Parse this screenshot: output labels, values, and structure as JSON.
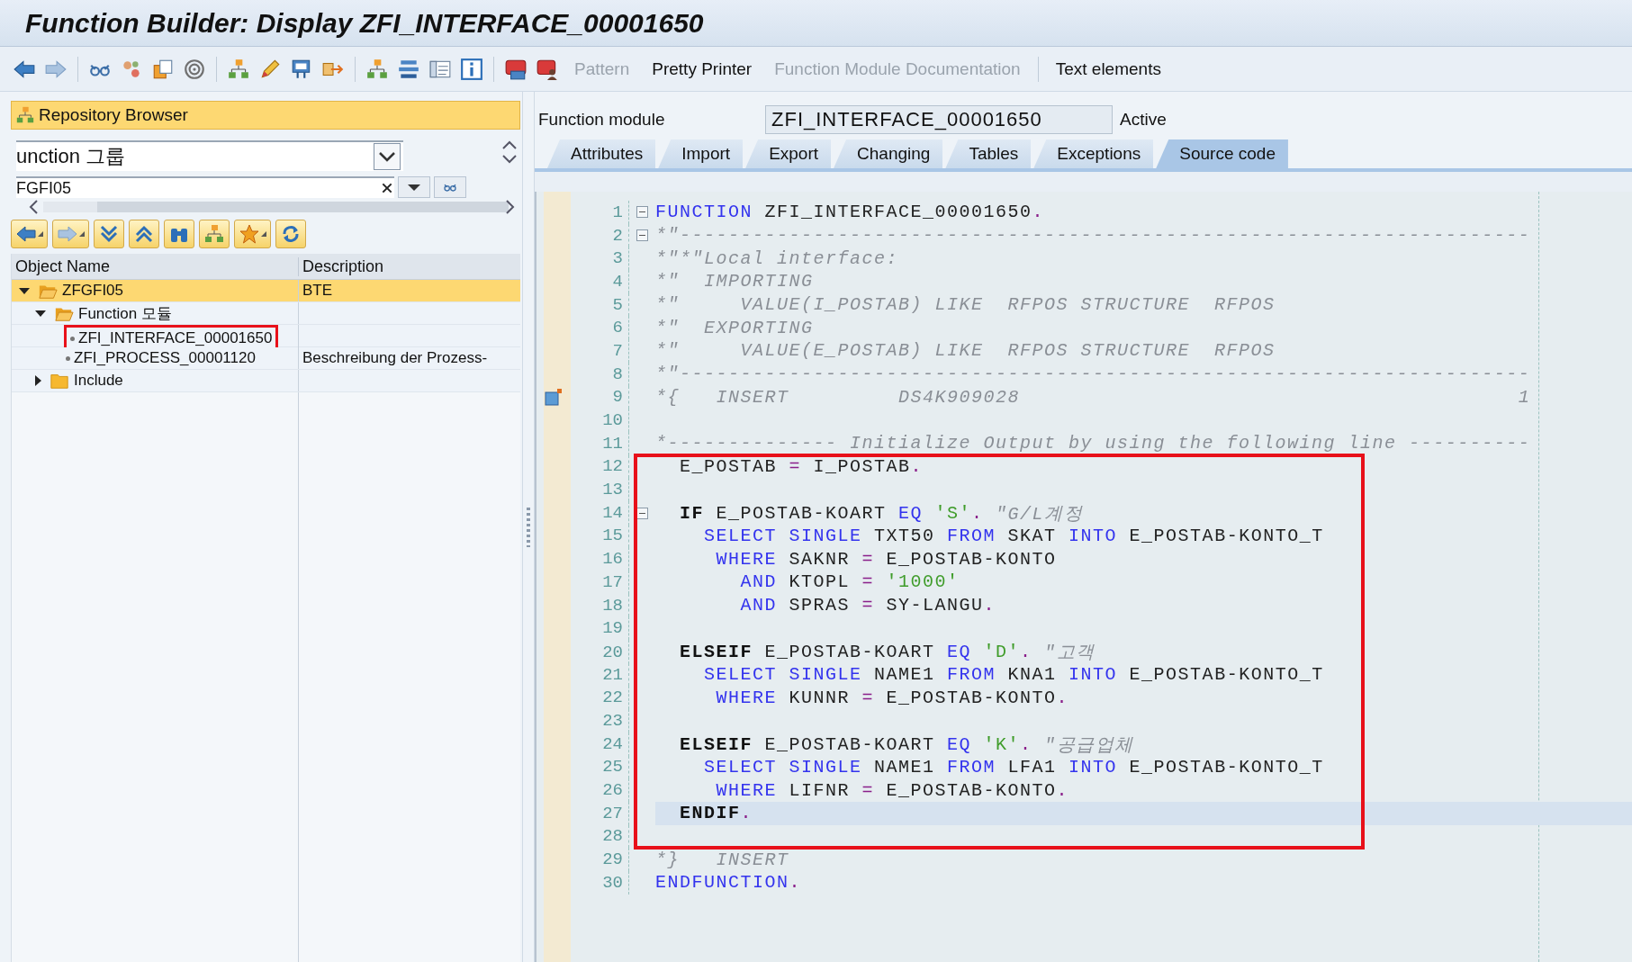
{
  "window": {
    "title": "Function Builder: Display ZFI_INTERFACE_00001650"
  },
  "toolbar": {
    "text_buttons": [
      {
        "label": "Pattern",
        "disabled": true
      },
      {
        "label": "Pretty Printer",
        "disabled": false
      },
      {
        "label": "Function Module Documentation",
        "disabled": true
      },
      {
        "label": "Text elements",
        "disabled": false
      }
    ]
  },
  "repository_browser": {
    "title": "Repository Browser",
    "object_type": "unction 그룹",
    "object_name": "FGFI05",
    "columns": [
      "Object Name",
      "Description"
    ],
    "tree": [
      {
        "name": "ZFGFI05",
        "description": "BTE",
        "kind": "folder",
        "expanded": true,
        "selected": true,
        "boxed": false,
        "children": [
          {
            "name": "Function 모듈",
            "kind": "folder",
            "expanded": true,
            "selected": false,
            "boxed": false,
            "children": [
              {
                "name": "ZFI_INTERFACE_00001650",
                "kind": "item",
                "selected": false,
                "boxed": true
              },
              {
                "name": "ZFI_PROCESS_00001120",
                "description": "Beschreibung der Prozess-",
                "kind": "item",
                "selected": false,
                "boxed": false
              }
            ]
          },
          {
            "name": "Include",
            "kind": "folder",
            "expanded": false,
            "selected": false,
            "boxed": false
          }
        ]
      }
    ]
  },
  "function_module": {
    "label": "Function module",
    "value": "ZFI_INTERFACE_00001650",
    "status": "Active"
  },
  "tabs": [
    {
      "label": "Attributes",
      "selected": false
    },
    {
      "label": "Import",
      "selected": false
    },
    {
      "label": "Export",
      "selected": false
    },
    {
      "label": "Changing",
      "selected": false
    },
    {
      "label": "Tables",
      "selected": false
    },
    {
      "label": "Exceptions",
      "selected": false
    },
    {
      "label": "Source code",
      "selected": true
    }
  ],
  "code_blocks": [
    {
      "boxed": false,
      "lines": [
        {
          "number": "1",
          "collapsible": true,
          "bookmark": false,
          "current": false,
          "tokens": [
            {
              "kind": "kw",
              "text": "FUNCTION"
            },
            {
              "kind": "txt",
              "text": " ZFI_INTERFACE_00001650"
            },
            {
              "kind": "op",
              "text": "."
            }
          ]
        },
        {
          "number": "2",
          "collapsible": true,
          "bookmark": false,
          "current": false,
          "tokens": [
            {
              "kind": "cmt",
              "text": "*\"----------------------------------------------------------------------"
            }
          ]
        },
        {
          "number": "3",
          "collapsible": false,
          "bookmark": false,
          "current": false,
          "tokens": [
            {
              "kind": "cmt",
              "text": "*\"*\"Local interface:"
            }
          ]
        },
        {
          "number": "4",
          "collapsible": false,
          "bookmark": false,
          "current": false,
          "tokens": [
            {
              "kind": "cmt",
              "text": "*\"  IMPORTING"
            }
          ]
        },
        {
          "number": "5",
          "collapsible": false,
          "bookmark": false,
          "current": false,
          "tokens": [
            {
              "kind": "cmt",
              "text": "*\"     VALUE(I_POSTAB) LIKE  RFPOS STRUCTURE  RFPOS"
            }
          ]
        },
        {
          "number": "6",
          "collapsible": false,
          "bookmark": false,
          "current": false,
          "tokens": [
            {
              "kind": "cmt",
              "text": "*\"  EXPORTING"
            }
          ]
        },
        {
          "number": "7",
          "collapsible": false,
          "bookmark": false,
          "current": false,
          "tokens": [
            {
              "kind": "cmt",
              "text": "*\"     VALUE(E_POSTAB) LIKE  RFPOS STRUCTURE  RFPOS"
            }
          ]
        },
        {
          "number": "8",
          "collapsible": false,
          "bookmark": false,
          "current": false,
          "tokens": [
            {
              "kind": "cmt",
              "text": "*\"----------------------------------------------------------------------"
            }
          ]
        },
        {
          "number": "9",
          "collapsible": false,
          "bookmark": true,
          "current": false,
          "tokens": [
            {
              "kind": "cmt",
              "text": "*{   INSERT         DS4K909028                                         1"
            }
          ]
        },
        {
          "number": "10",
          "collapsible": false,
          "bookmark": false,
          "current": false
        },
        {
          "number": "11",
          "collapsible": false,
          "bookmark": false,
          "current": false,
          "tokens": [
            {
              "kind": "cmt",
              "text": "*-------------- Initialize Output by using the following line ----------"
            }
          ]
        }
      ]
    },
    {
      "boxed": true,
      "lines": [
        {
          "number": "12",
          "collapsible": false,
          "bookmark": false,
          "current": false,
          "tokens": [
            {
              "kind": "txt",
              "text": "  E_POSTAB "
            },
            {
              "kind": "op",
              "text": "="
            },
            {
              "kind": "txt",
              "text": " I_POSTAB"
            },
            {
              "kind": "op",
              "text": "."
            }
          ]
        },
        {
          "number": "13",
          "collapsible": false,
          "bookmark": false,
          "current": false
        },
        {
          "number": "14",
          "collapsible": true,
          "bookmark": false,
          "current": false,
          "tokens": [
            {
              "kind": "bold",
              "text": "  IF"
            },
            {
              "kind": "txt",
              "text": " E_POSTAB-KOART "
            },
            {
              "kind": "kw",
              "text": "EQ"
            },
            {
              "kind": "str",
              "text": " 'S'"
            },
            {
              "kind": "op",
              "text": "."
            },
            {
              "kind": "cmt",
              "text": " \"G/L계정"
            }
          ]
        },
        {
          "number": "15",
          "collapsible": false,
          "bookmark": false,
          "current": false,
          "tokens": [
            {
              "kind": "kw",
              "text": "    SELECT"
            },
            {
              "kind": "kw",
              "text": " SINGLE"
            },
            {
              "kind": "txt",
              "text": " TXT50 "
            },
            {
              "kind": "kw",
              "text": "FROM"
            },
            {
              "kind": "txt",
              "text": " SKAT "
            },
            {
              "kind": "kw",
              "text": "INTO"
            },
            {
              "kind": "txt",
              "text": " E_POSTAB-KONTO_T"
            }
          ]
        },
        {
          "number": "16",
          "collapsible": false,
          "bookmark": false,
          "current": false,
          "tokens": [
            {
              "kind": "kw",
              "text": "     WHERE"
            },
            {
              "kind": "txt",
              "text": " SAKNR "
            },
            {
              "kind": "op",
              "text": "="
            },
            {
              "kind": "txt",
              "text": " E_POSTAB-KONTO"
            }
          ]
        },
        {
          "number": "17",
          "collapsible": false,
          "bookmark": false,
          "current": false,
          "tokens": [
            {
              "kind": "kw",
              "text": "       AND"
            },
            {
              "kind": "txt",
              "text": " KTOPL "
            },
            {
              "kind": "op",
              "text": "="
            },
            {
              "kind": "str",
              "text": " '1000'"
            }
          ]
        },
        {
          "number": "18",
          "collapsible": false,
          "bookmark": false,
          "current": false,
          "tokens": [
            {
              "kind": "kw",
              "text": "       AND"
            },
            {
              "kind": "txt",
              "text": " SPRAS "
            },
            {
              "kind": "op",
              "text": "="
            },
            {
              "kind": "txt",
              "text": " SY-LANGU"
            },
            {
              "kind": "op",
              "text": "."
            }
          ]
        },
        {
          "number": "19",
          "collapsible": false,
          "bookmark": false,
          "current": false
        },
        {
          "number": "20",
          "collapsible": false,
          "bookmark": false,
          "current": false,
          "tokens": [
            {
              "kind": "bold",
              "text": "  ELSEIF"
            },
            {
              "kind": "txt",
              "text": " E_POSTAB-KOART "
            },
            {
              "kind": "kw",
              "text": "EQ"
            },
            {
              "kind": "str",
              "text": " 'D'"
            },
            {
              "kind": "op",
              "text": "."
            },
            {
              "kind": "cmt",
              "text": " \"고객"
            }
          ]
        },
        {
          "number": "21",
          "collapsible": false,
          "bookmark": false,
          "current": false,
          "tokens": [
            {
              "kind": "kw",
              "text": "    SELECT"
            },
            {
              "kind": "kw",
              "text": " SINGLE"
            },
            {
              "kind": "txt",
              "text": " NAME1 "
            },
            {
              "kind": "kw",
              "text": "FROM"
            },
            {
              "kind": "txt",
              "text": " KNA1 "
            },
            {
              "kind": "kw",
              "text": "INTO"
            },
            {
              "kind": "txt",
              "text": " E_POSTAB-KONTO_T"
            }
          ]
        },
        {
          "number": "22",
          "collapsible": false,
          "bookmark": false,
          "current": false,
          "tokens": [
            {
              "kind": "kw",
              "text": "     WHERE"
            },
            {
              "kind": "txt",
              "text": " KUNNR "
            },
            {
              "kind": "op",
              "text": "="
            },
            {
              "kind": "txt",
              "text": " E_POSTAB-KONTO"
            },
            {
              "kind": "op",
              "text": "."
            }
          ]
        },
        {
          "number": "23",
          "collapsible": false,
          "bookmark": false,
          "current": false
        },
        {
          "number": "24",
          "collapsible": false,
          "bookmark": false,
          "current": false,
          "tokens": [
            {
              "kind": "bold",
              "text": "  ELSEIF"
            },
            {
              "kind": "txt",
              "text": " E_POSTAB-KOART "
            },
            {
              "kind": "kw",
              "text": "EQ"
            },
            {
              "kind": "str",
              "text": " 'K'"
            },
            {
              "kind": "op",
              "text": "."
            },
            {
              "kind": "cmt",
              "text": " \"공급업체"
            }
          ]
        },
        {
          "number": "25",
          "collapsible": false,
          "bookmark": false,
          "current": false,
          "tokens": [
            {
              "kind": "kw",
              "text": "    SELECT"
            },
            {
              "kind": "kw",
              "text": " SINGLE"
            },
            {
              "kind": "txt",
              "text": " NAME1 "
            },
            {
              "kind": "kw",
              "text": "FROM"
            },
            {
              "kind": "txt",
              "text": " LFA1 "
            },
            {
              "kind": "kw",
              "text": "INTO"
            },
            {
              "kind": "txt",
              "text": " E_POSTAB-KONTO_T"
            }
          ]
        },
        {
          "number": "26",
          "collapsible": false,
          "bookmark": false,
          "current": false,
          "tokens": [
            {
              "kind": "kw",
              "text": "     WHERE"
            },
            {
              "kind": "txt",
              "text": " LIFNR "
            },
            {
              "kind": "op",
              "text": "="
            },
            {
              "kind": "txt",
              "text": " E_POSTAB-KONTO"
            },
            {
              "kind": "op",
              "text": "."
            }
          ]
        },
        {
          "number": "27",
          "collapsible": false,
          "bookmark": false,
          "current": true,
          "tokens": [
            {
              "kind": "bold",
              "text": "  ENDIF"
            },
            {
              "kind": "op",
              "text": "."
            }
          ]
        },
        {
          "number": "28",
          "collapsible": false,
          "bookmark": false,
          "current": false
        }
      ]
    },
    {
      "boxed": false,
      "lines": [
        {
          "number": "29",
          "collapsible": false,
          "bookmark": false,
          "current": false,
          "tokens": [
            {
              "kind": "cmt",
              "text": "*}   INSERT"
            }
          ]
        },
        {
          "number": "30",
          "collapsible": false,
          "bookmark": false,
          "current": false,
          "tokens": [
            {
              "kind": "kw",
              "text": "ENDFUNCTION"
            },
            {
              "kind": "op",
              "text": "."
            }
          ]
        }
      ]
    }
  ]
}
